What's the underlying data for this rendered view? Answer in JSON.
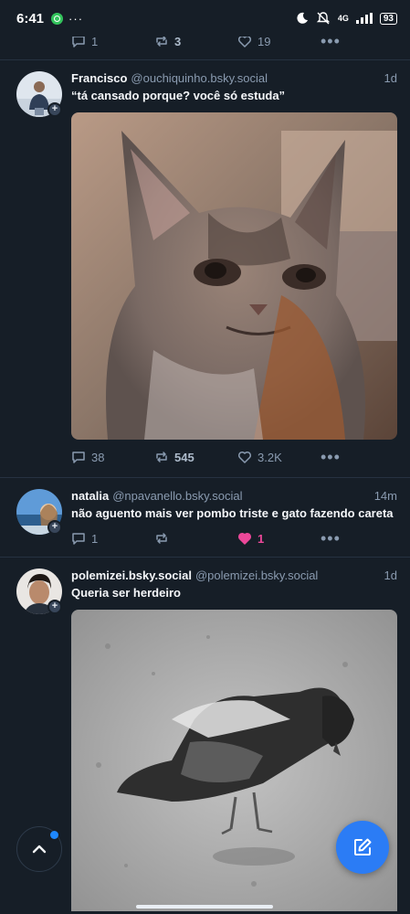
{
  "status_bar": {
    "time": "6:41",
    "network": "4G",
    "battery": "93"
  },
  "top_post_actions": {
    "replies": "1",
    "reposts": "3",
    "likes": "19"
  },
  "posts": [
    {
      "name": "Francisco",
      "handle": "@ouchiquinho.bsky.social",
      "time": "1d",
      "text": "“tá cansado porque? você só estuda”",
      "media": "gif-angry-cat",
      "replies": "38",
      "reposts": "545",
      "likes": "3.2K"
    },
    {
      "name": "natalia",
      "handle": "@npavanello.bsky.social",
      "time": "14m",
      "text": "não aguento mais ver pombo triste e gato fazendo careta",
      "replies": "1",
      "reposts": "",
      "likes": "1"
    },
    {
      "name": "polemizei.bsky.social",
      "handle": "@polemizei.bsky.social",
      "time": "1d",
      "text": "Queria ser herdeiro",
      "media": "gif-pigeon"
    }
  ],
  "colors": {
    "background": "#161e27",
    "accent": "#2b7cf5",
    "like": "#ec4899",
    "muted": "#8a9bb0"
  },
  "icons": {
    "reply": "reply-icon",
    "repost": "repost-icon",
    "like": "heart-icon",
    "more": "more-icon",
    "compose": "compose-icon",
    "scroll_top": "chevron-up-icon"
  }
}
